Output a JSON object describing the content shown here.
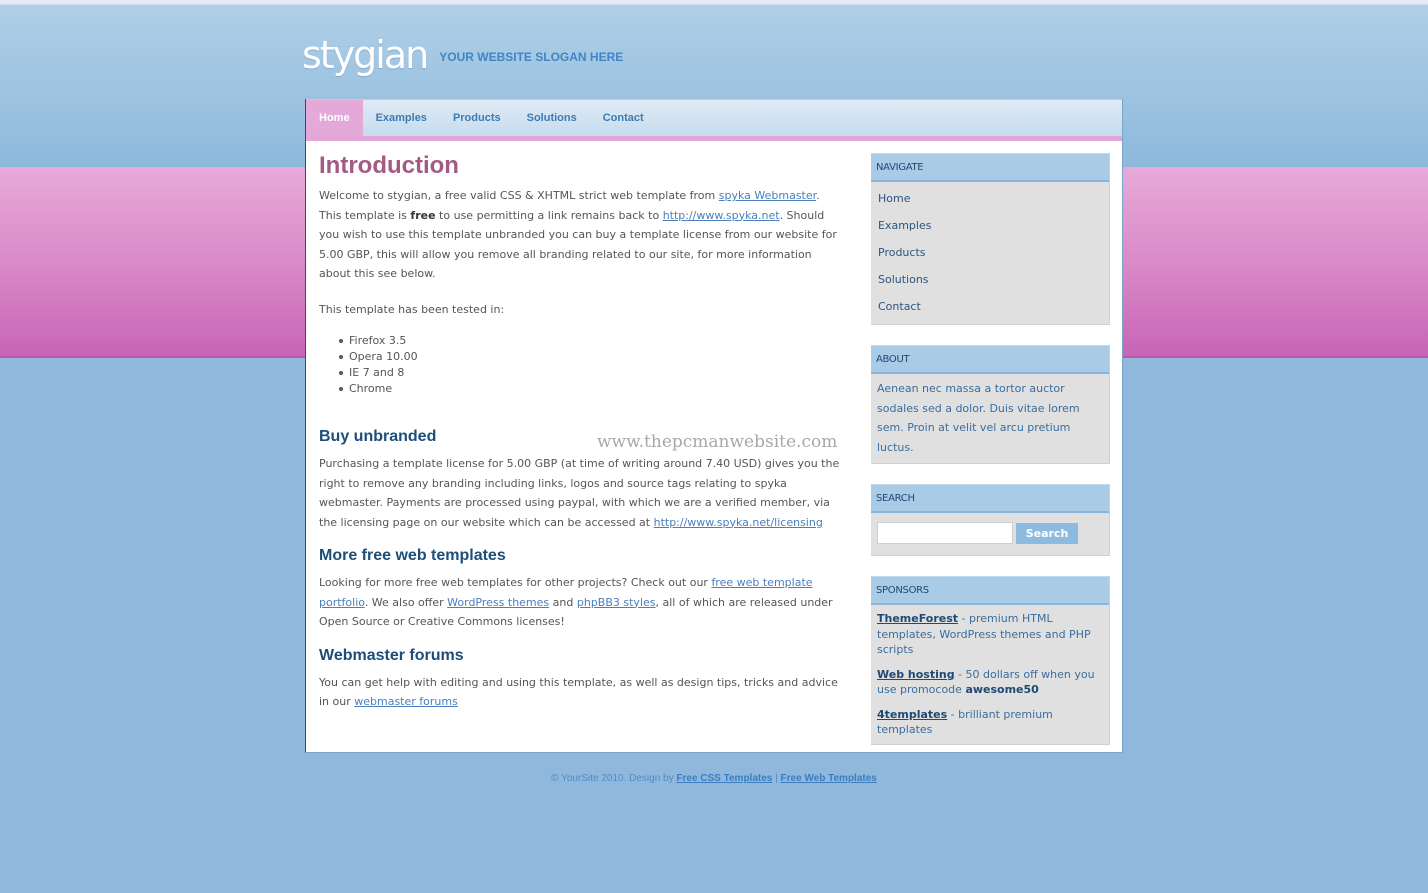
{
  "header": {
    "logo": "stygian",
    "slogan": "YOUR WEBSITE SLOGAN HERE"
  },
  "nav": {
    "items": [
      {
        "label": "Home",
        "active": true
      },
      {
        "label": "Examples",
        "active": false
      },
      {
        "label": "Products",
        "active": false
      },
      {
        "label": "Solutions",
        "active": false
      },
      {
        "label": "Contact",
        "active": false
      }
    ]
  },
  "content": {
    "title": "Introduction",
    "intro": {
      "t1": "Welcome to stygian, a free valid CSS & XHTML strict web template from ",
      "link1": "spyka Webmaster",
      "t2": ". This template is ",
      "bold": "free",
      "t3": " to use permitting a link remains back to ",
      "link2": "http://www.spyka.net",
      "t4": ". Should you wish to use this template unbranded you can buy a template license from our website for 5.00 GBP, this will allow you remove all branding related to our site, for more information about this see below."
    },
    "tested_label": "This template has been tested in:",
    "tested_list": [
      "Firefox 3.5",
      "Opera 10.00",
      "IE 7 and 8",
      "Chrome"
    ],
    "watermark": "www.thepcmanwebsite.com",
    "buy": {
      "heading": "Buy unbranded",
      "text": "Purchasing a template license for 5.00 GBP (at time of writing around 7.40 USD) gives you the right to remove any branding including links, logos and source tags relating to spyka webmaster. Payments are processed using paypal, with which we are a verified member, via the licensing page on our website which can be accessed at ",
      "link": "http://www.spyka.net/licensing"
    },
    "more": {
      "heading": "More free web templates",
      "t1": "Looking for more free web templates for other projects? Check out our ",
      "link1": "free web template portfolio",
      "t2": ". We also offer ",
      "link2": "WordPress themes",
      "t3": " and ",
      "link3": "phpBB3 styles",
      "t4": ", all of which are released under Open Source or Creative Commons licenses!"
    },
    "forums": {
      "heading": "Webmaster forums",
      "text": "You can get help with editing and using this template, as well as design tips, tricks and advice in our ",
      "link": "webmaster forums"
    }
  },
  "sidebar": {
    "navigate": {
      "title": "NAVIGATE",
      "items": [
        "Home",
        "Examples",
        "Products",
        "Solutions",
        "Contact"
      ]
    },
    "about": {
      "title": "ABOUT",
      "text": "Aenean nec massa a tortor auctor sodales sed a dolor. Duis vitae lorem sem. Proin at velit vel arcu pretium luctus."
    },
    "search": {
      "title": "SEARCH",
      "value": "",
      "placeholder": "",
      "button": "Search"
    },
    "sponsors": {
      "title": "SPONSORS",
      "items": [
        {
          "link": "ThemeForest",
          "text": " - premium HTML templates, WordPress themes and PHP scripts",
          "bold": ""
        },
        {
          "link": "Web hosting",
          "text": " - 50 dollars off when you use promocode ",
          "bold": "awesome50"
        },
        {
          "link": "4templates",
          "text": " - brilliant premium templates",
          "bold": ""
        }
      ]
    }
  },
  "footer": {
    "text": "© YourSite 2010. Design by ",
    "link1": "Free CSS Templates",
    "sep": " | ",
    "link2": "Free Web Templates"
  }
}
